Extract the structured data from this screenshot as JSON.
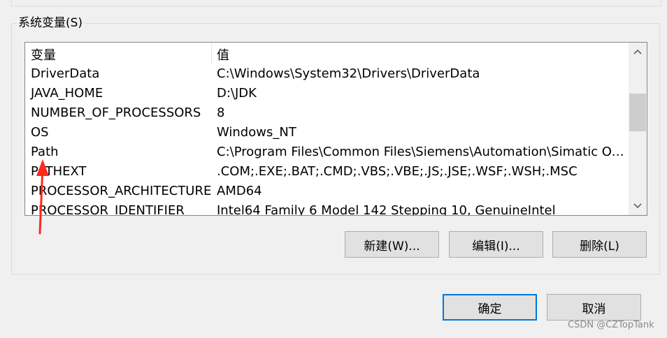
{
  "group": {
    "title": "系统变量(S)",
    "columns": {
      "name": "变量",
      "value": "值"
    },
    "rows": [
      {
        "name": "DriverData",
        "value": "C:\\Windows\\System32\\Drivers\\DriverData"
      },
      {
        "name": "JAVA_HOME",
        "value": "D:\\JDK"
      },
      {
        "name": "NUMBER_OF_PROCESSORS",
        "value": "8"
      },
      {
        "name": "OS",
        "value": "Windows_NT"
      },
      {
        "name": "Path",
        "value": "C:\\Program Files\\Common Files\\Siemens\\Automation\\Simatic OA..."
      },
      {
        "name": "PATHEXT",
        "value": ".COM;.EXE;.BAT;.CMD;.VBS;.VBE;.JS;.JSE;.WSF;.WSH;.MSC"
      },
      {
        "name": "PROCESSOR_ARCHITECTURE",
        "value": "AMD64"
      },
      {
        "name": "PROCESSOR_IDENTIFIER",
        "value": "Intel64 Family 6 Model 142 Stepping 10, GenuineIntel"
      }
    ]
  },
  "actions": {
    "new_label": "新建(W)...",
    "edit_label": "编辑(I)...",
    "delete_label": "删除(L)"
  },
  "footer": {
    "ok_label": "确定",
    "cancel_label": "取消"
  },
  "annotation": {
    "arrow_color": "#ff2a1a"
  },
  "watermark": "CSDN @CZTopTank",
  "colors": {
    "focus_border": "#0078d7",
    "button_bg": "#e1e1e1"
  }
}
